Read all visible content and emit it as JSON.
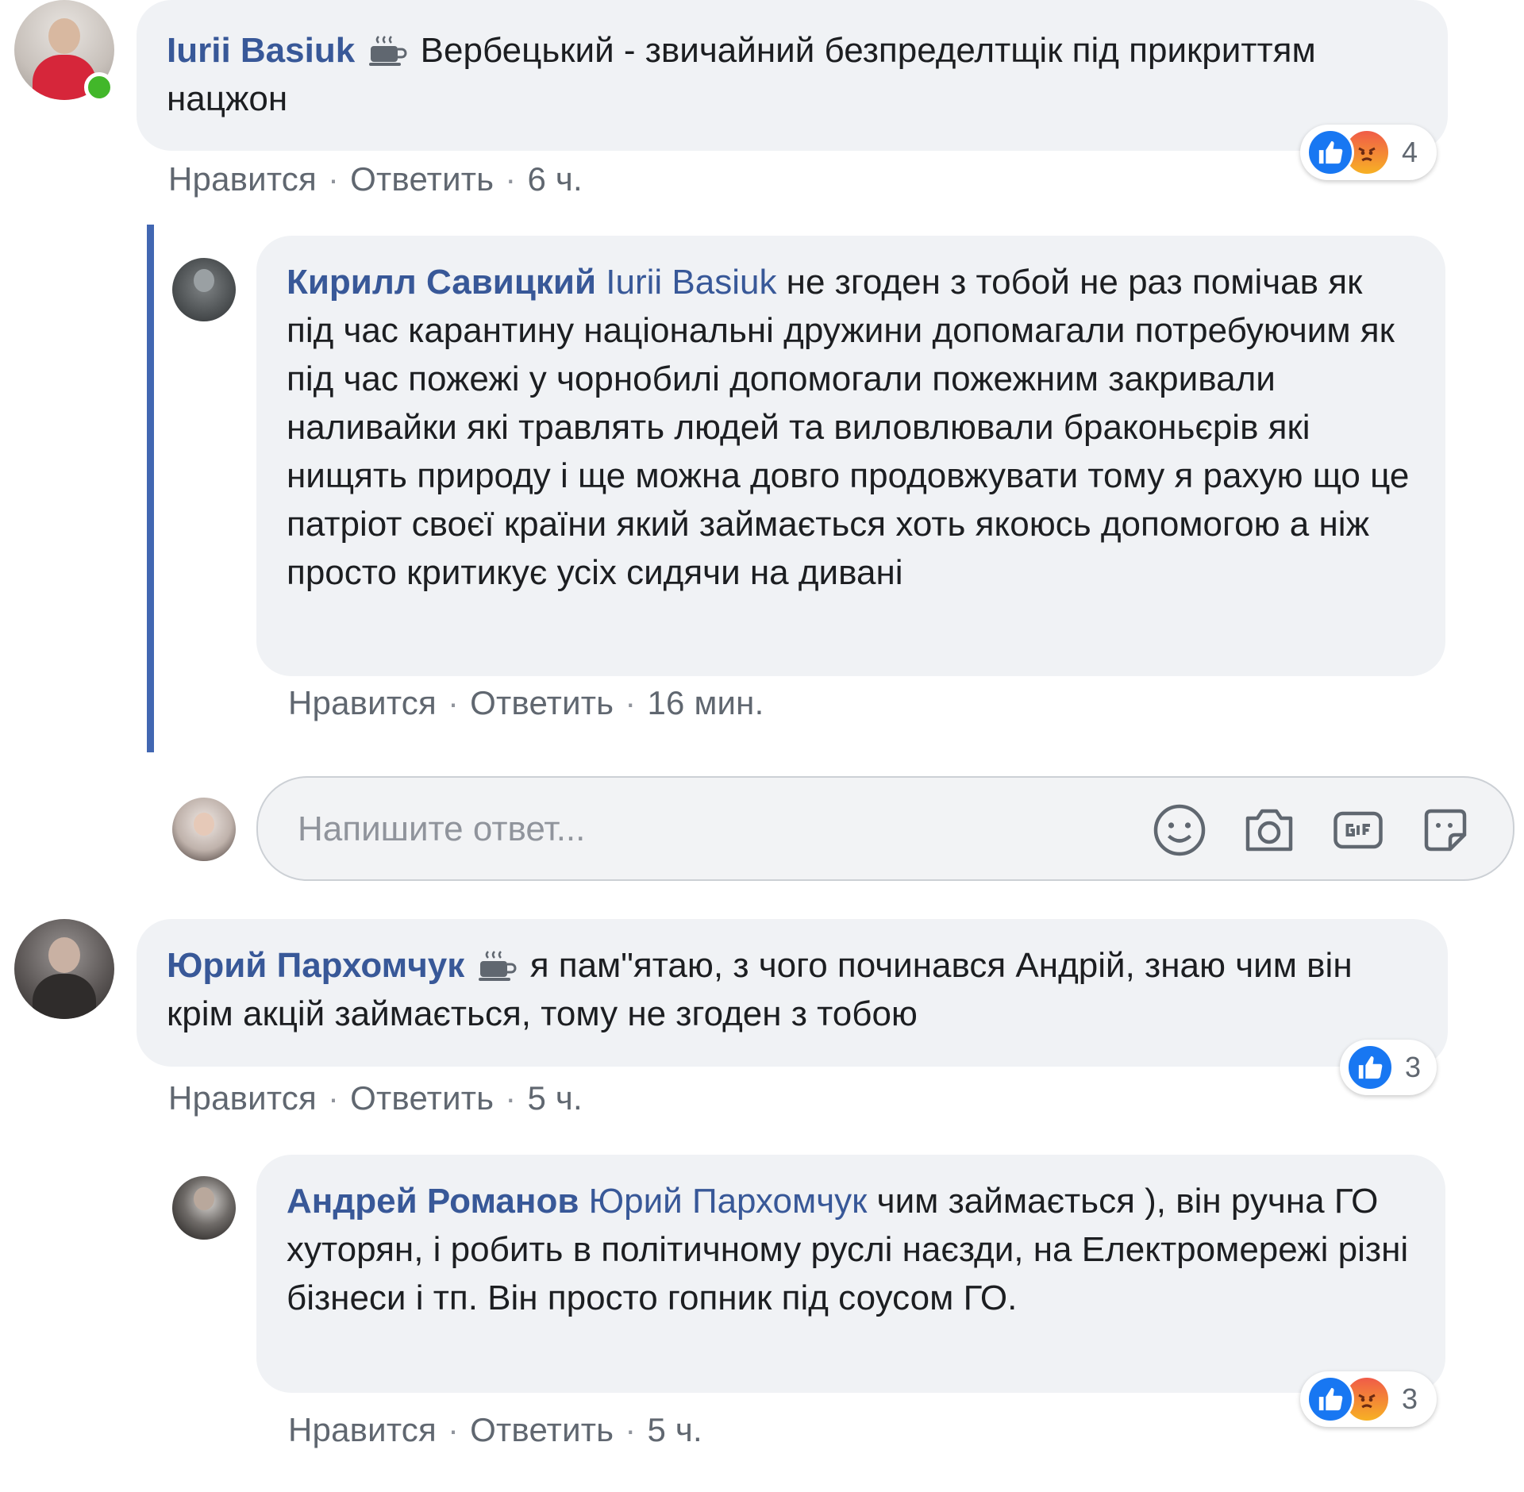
{
  "comments": [
    {
      "author": "Iurii Basiuk",
      "text": "Вербецький - звичайний безпределтщік під прикриттям нацжон",
      "reactions": {
        "types": [
          "like",
          "angry"
        ],
        "count": "4"
      },
      "actions": {
        "like": "Нравится",
        "reply": "Ответить",
        "time": "6 ч."
      },
      "online": true,
      "badge_icon": "coffee-cup-icon",
      "replies": [
        {
          "author": "Кирилл Савицкий",
          "mention": "Iurii Basiuk",
          "text": "не згоден з тобой не раз помічав як під час карантину національні дружини допомагали потребуючим як під час пожежі у чорнобилі допомогали пожежним закривали наливайки які травлять людей та виловлювали браконьєрів які нищять природу і ще можна довго продовжувати тому я рахую що це патріот своєї країни який займається хоть якоюсь допомогою а ніж просто критикує усіх сидячи на дивані",
          "actions": {
            "like": "Нравится",
            "reply": "Ответить",
            "time": "16 мин."
          }
        }
      ],
      "reply_box": {
        "placeholder": "Напишите ответ...",
        "tools": [
          "emoji-icon",
          "camera-icon",
          "gif-icon",
          "sticker-icon"
        ]
      }
    },
    {
      "author": "Юрий Пархомчук",
      "text": "я пам\"ятаю, з чого починався Андрій, знаю чим він крім акцій займається, тому не згоден з тобою",
      "reactions": {
        "types": [
          "like"
        ],
        "count": "3"
      },
      "actions": {
        "like": "Нравится",
        "reply": "Ответить",
        "time": "5 ч."
      },
      "badge_icon": "coffee-cup-icon",
      "replies": [
        {
          "author": "Андрей Романов",
          "mention": "Юрий Пархомчук",
          "text": "чим займається ), він ручна ГО хуторян, і робить в політичному руслі наєзди, на Електромережі різні бізнеси і тп. Він просто гопник під соусом ГО.",
          "reactions": {
            "types": [
              "like",
              "angry"
            ],
            "count": "3"
          },
          "actions": {
            "like": "Нравится",
            "reply": "Ответить",
            "time": "5 ч."
          }
        }
      ]
    }
  ],
  "colors": {
    "author": "#385898",
    "bubble": "#f0f2f5",
    "meta": "#606770",
    "like": "#1877f2",
    "thread_line": "#4267b2",
    "online": "#42b72a"
  }
}
